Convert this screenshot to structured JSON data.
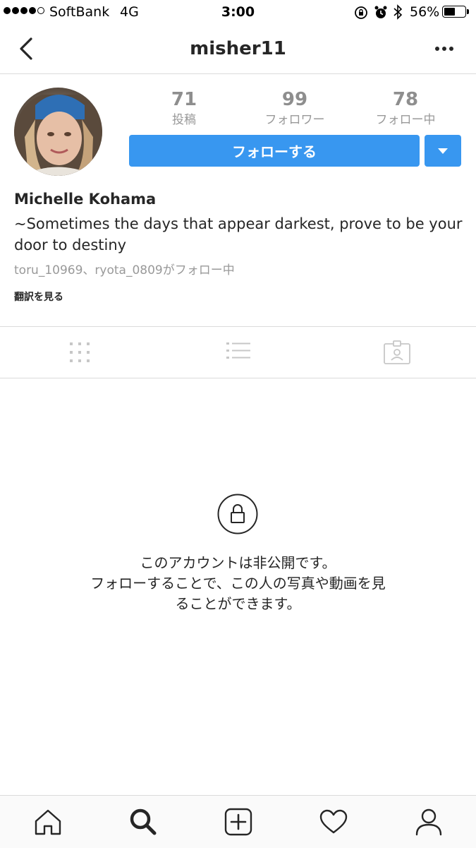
{
  "status_bar": {
    "carrier": "SoftBank",
    "network": "4G",
    "time": "3:00",
    "battery": "56%",
    "battery_level": 0.56
  },
  "nav": {
    "title": "misher11"
  },
  "profile": {
    "posts_count": "71",
    "posts_label": "投稿",
    "followers_count": "99",
    "followers_label": "フォロワー",
    "following_count": "78",
    "following_label": "フォロー中",
    "follow_button": "フォローする",
    "name": "Michelle Kohama",
    "bio": "~Sometimes the days that appear darkest, prove to be your door to destiny",
    "followed_by": "toru_10969、ryota_0809がフォロー中",
    "translate_link": "翻訳を見る"
  },
  "private_notice": {
    "line1": "このアカウントは非公開です。",
    "line2": "フォローすることで、この人の写真や動画を見",
    "line3": "ることができます。"
  },
  "colors": {
    "accent": "#3897f0",
    "muted": "#999999",
    "divider": "#dbdbdb"
  },
  "icons": [
    "back-icon",
    "more-icon",
    "grid-icon",
    "list-icon",
    "tagged-icon",
    "lock-icon",
    "home-icon",
    "search-icon",
    "add-icon",
    "heart-icon",
    "profile-icon"
  ]
}
